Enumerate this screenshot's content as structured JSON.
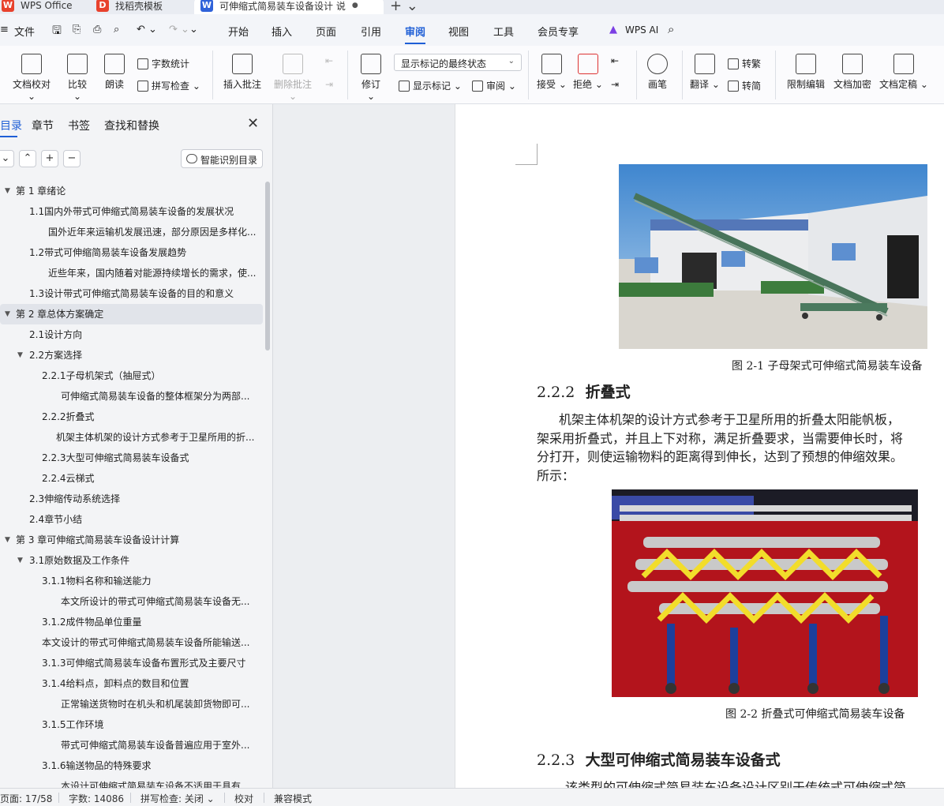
{
  "tabs": {
    "wps": "WPS Office",
    "template": "找稻壳模板",
    "doc": "可伸缩式简易装车设备设计 说",
    "plus": "+ ⌄"
  },
  "menu": {
    "file": "文件",
    "items": [
      "开始",
      "插入",
      "页面",
      "引用",
      "审阅",
      "视图",
      "工具",
      "会员专享"
    ],
    "active": "审阅",
    "wps_ai": "WPS AI"
  },
  "ribbon": {
    "proofread": "文档校对",
    "compare": "比较",
    "read_aloud": "朗读",
    "word_count": "字数统计",
    "spell_check": "拼写检查",
    "insert_comment": "插入批注",
    "delete_comment": "删除批注",
    "revise": "修订",
    "markup_state": "显示标记的最终状态",
    "show_markup": "显示标记",
    "review": "审阅",
    "accept": "接受",
    "reject": "拒绝",
    "pen": "画笔",
    "translate": "翻译",
    "to_traditional": "转繁",
    "to_simplified": "转简",
    "restrict_edit": "限制编辑",
    "encrypt": "文档加密",
    "finalize": "文档定稿"
  },
  "nav": {
    "tabs": [
      "目录",
      "章节",
      "书签",
      "查找和替换"
    ],
    "smart_toc": "智能识别目录",
    "toc": [
      {
        "text": "第 1 章绪论",
        "level": 0,
        "toggle": "▼"
      },
      {
        "text": "1.1国内外带式可伸缩式简易装车设备的发展状况",
        "level": 1,
        "toggle": ""
      },
      {
        "text": "国外近年来运输机发展迅速，部分原因是多样化...",
        "level": 3,
        "toggle": ""
      },
      {
        "text": "1.2带式可伸缩简易装车设备发展趋势",
        "level": 1,
        "toggle": ""
      },
      {
        "text": "近些年来，国内随着对能源持续增长的需求，使...",
        "level": 3,
        "toggle": ""
      },
      {
        "text": "1.3设计带式可伸缩式简易装车设备的目的和意义",
        "level": 1,
        "toggle": ""
      },
      {
        "text": "第 2 章总体方案确定",
        "level": 0,
        "toggle": "▼",
        "selected": true
      },
      {
        "text": "2.1设计方向",
        "level": 1,
        "toggle": ""
      },
      {
        "text": "2.2方案选择",
        "level": 1,
        "toggle": "▼"
      },
      {
        "text": "2.2.1子母机架式（抽屉式）",
        "level": 2,
        "toggle": ""
      },
      {
        "text": "可伸缩式简易装车设备的整体框架分为两部...",
        "level": 3,
        "toggle": ""
      },
      {
        "text": "2.2.2折叠式",
        "level": 2,
        "toggle": ""
      },
      {
        "text": "机架主体机架的设计方式参考于卫星所用的折...",
        "level": 4,
        "toggle": ""
      },
      {
        "text": "2.2.3大型可伸缩式简易装车设备式",
        "level": 2,
        "toggle": ""
      },
      {
        "text": "2.2.4云梯式",
        "level": 2,
        "toggle": ""
      },
      {
        "text": "2.3伸缩传动系统选择",
        "level": 1,
        "toggle": ""
      },
      {
        "text": "2.4章节小结",
        "level": 1,
        "toggle": ""
      },
      {
        "text": "第 3 章可伸缩式简易装车设备设计计算",
        "level": 0,
        "toggle": "▼"
      },
      {
        "text": "3.1原始数据及工作条件",
        "level": 1,
        "toggle": "▼"
      },
      {
        "text": "3.1.1物料名称和输送能力",
        "level": 2,
        "toggle": ""
      },
      {
        "text": "本文所设计的带式可伸缩式简易装车设备无...",
        "level": 3,
        "toggle": ""
      },
      {
        "text": "3.1.2成件物品单位重量",
        "level": 2,
        "toggle": ""
      },
      {
        "text": "本文设计的带式可伸缩式简易装车设备所能输送...",
        "level": 5,
        "toggle": ""
      },
      {
        "text": "3.1.3可伸缩式简易装车设备布置形式及主要尺寸",
        "level": 2,
        "toggle": ""
      },
      {
        "text": "3.1.4给料点，卸料点的数目和位置",
        "level": 2,
        "toggle": ""
      },
      {
        "text": "正常输送货物时在机头和机尾装卸货物即可...",
        "level": 3,
        "toggle": ""
      },
      {
        "text": "3.1.5工作环境",
        "level": 2,
        "toggle": ""
      },
      {
        "text": "带式可伸缩式简易装车设备普遍应用于室外...",
        "level": 3,
        "toggle": ""
      },
      {
        "text": "3.1.6输送物品的特殊要求",
        "level": 2,
        "toggle": ""
      },
      {
        "text": "本设计可伸缩式简易装车设备不适用于具有...",
        "level": 3,
        "toggle": ""
      }
    ]
  },
  "document": {
    "caption_1": "图 2-1  子母架式可伸缩式简易装车设备",
    "heading_222_num": "2.2.2",
    "heading_222_title": "折叠式",
    "para_lines": [
      "机架主体机架的设计方式参考于卫星所用的折叠太阳能帆板，",
      "架采用折叠式，并且上下对称，满足折叠要求，当需要伸长时，将",
      "分打开，则使运输物料的距离得到伸长，达到了预想的伸缩效果。",
      "所示："
    ],
    "caption_2": "图 2-2  折叠式可伸缩式简易装车设备",
    "heading_223_num": "2.2.3",
    "heading_223_title": "大型可伸缩式简易装车设备式",
    "para_cut": "该类型的可伸缩式简易装车设备设计区别于传统式可伸缩式简"
  },
  "status": {
    "page": "页面: 17/58",
    "words": "字数: 14086",
    "spell": "拼写检查: 关闭 ⌄",
    "proof": "校对",
    "compat": "兼容模式"
  },
  "colors": {
    "accent": "#1f5fd6",
    "wps_red": "#e8412c",
    "doc_blue": "#2f62d9"
  }
}
